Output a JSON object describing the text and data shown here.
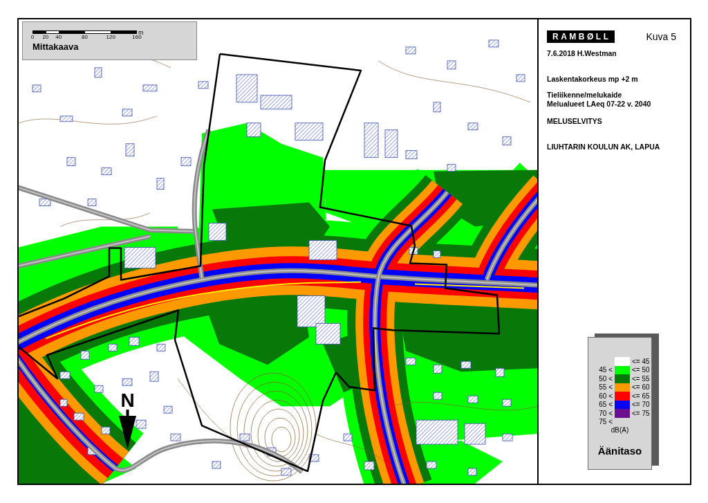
{
  "map": {
    "scale_bar": {
      "ticks": [
        "0",
        "20",
        "40",
        "80",
        "120",
        "160"
      ],
      "unit": "m",
      "title": "Mittakaava"
    },
    "north_arrow": {
      "label": "N"
    }
  },
  "title_block": {
    "logo": "RAMBØLL",
    "figure": "Kuva 5",
    "date_author": "7.6.2018 H.Westman",
    "calculation_height": "Laskentakorkeus mp +2 m",
    "description": [
      "Tieliikenne/melukaide",
      "Melualueet LAeq 07-22 v. 2040"
    ],
    "report": "MELUSELVITYS",
    "project": "LIUHTARIN KOULUN AK, LAPUA"
  },
  "legend": {
    "rows": [
      {
        "upper": "<= 45",
        "color": "#ffffff"
      },
      {
        "lower": "45 <",
        "upper": "<= 50",
        "color": "#00ff00"
      },
      {
        "lower": "50 <",
        "upper": "<= 55",
        "color": "#087808"
      },
      {
        "lower": "55 <",
        "upper": "<= 60",
        "color": "#ff9900"
      },
      {
        "lower": "60 <",
        "upper": "<= 65",
        "color": "#ff0000"
      },
      {
        "lower": "65 <",
        "upper": "<= 70",
        "color": "#0000ff"
      },
      {
        "lower": "70 <",
        "upper": "<= 75",
        "color": "#6a0f8e"
      },
      {
        "lower": "75 <"
      }
    ],
    "unit": "dB(A)",
    "title": "Äänitaso"
  }
}
